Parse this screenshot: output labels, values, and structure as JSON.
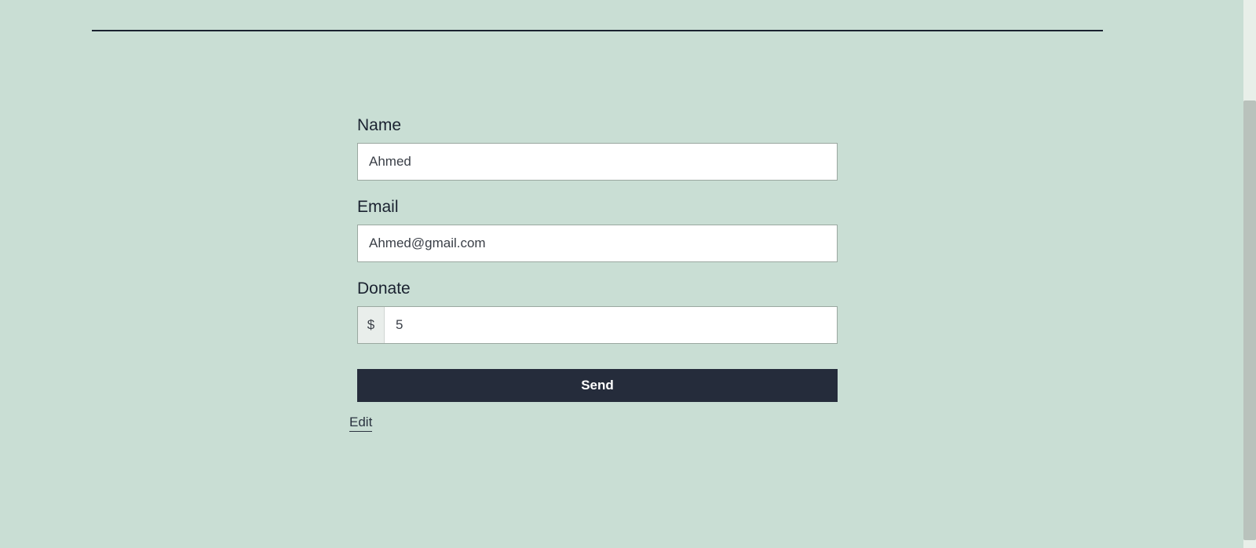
{
  "form": {
    "name": {
      "label": "Name",
      "value": "Ahmed"
    },
    "email": {
      "label": "Email",
      "value": "Ahmed@gmail.com"
    },
    "donate": {
      "label": "Donate",
      "currency_symbol": "$",
      "value": "5"
    },
    "submit_label": "Send"
  },
  "edit_link": "Edit"
}
